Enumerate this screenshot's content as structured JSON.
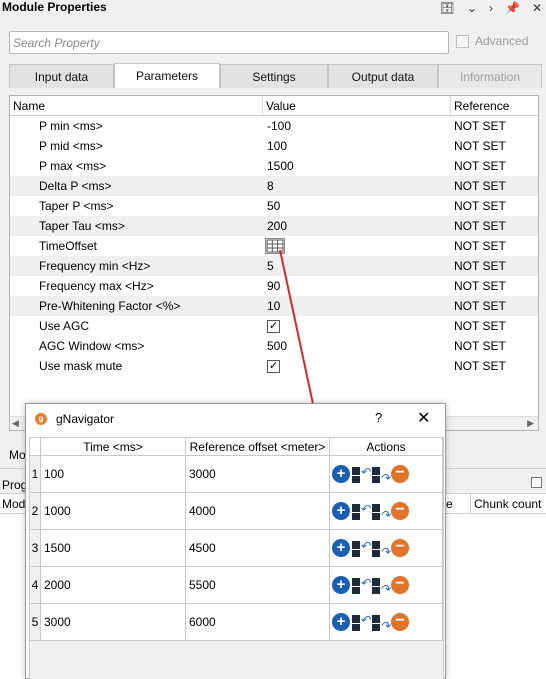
{
  "panel": {
    "title": "Module Properties",
    "search_placeholder": "Search Property",
    "advanced_label": "Advanced"
  },
  "header_icons": [
    "database-settings-icon",
    "chevron-down-icon",
    "chevron-right-icon",
    "pin-icon",
    "close-icon"
  ],
  "tabs": [
    {
      "label": "Input data"
    },
    {
      "label": "Parameters"
    },
    {
      "label": "Settings"
    },
    {
      "label": "Output data"
    },
    {
      "label": "Information"
    }
  ],
  "table": {
    "headers": {
      "name": "Name",
      "value": "Value",
      "reference": "Reference"
    },
    "rows": [
      {
        "name": "P min <ms>",
        "value": "-100",
        "reference": "NOT SET"
      },
      {
        "name": "P mid <ms>",
        "value": "100",
        "reference": "NOT SET"
      },
      {
        "name": "P max <ms>",
        "value": "1500",
        "reference": "NOT SET"
      },
      {
        "name": "Delta P <ms>",
        "value": "8",
        "reference": "NOT SET"
      },
      {
        "name": "Taper P <ms>",
        "value": "50",
        "reference": "NOT SET"
      },
      {
        "name": "Taper Tau <ms>",
        "value": "200",
        "reference": "NOT SET"
      },
      {
        "name": "TimeOffset",
        "value": "",
        "reference": "NOT SET"
      },
      {
        "name": "Frequency min <Hz>",
        "value": "5",
        "reference": "NOT SET"
      },
      {
        "name": "Frequency max <Hz>",
        "value": "90",
        "reference": "NOT SET"
      },
      {
        "name": "Pre-Whitening Factor <%>",
        "value": "10",
        "reference": "NOT SET"
      },
      {
        "name": "Use AGC",
        "value": "",
        "reference": "NOT SET"
      },
      {
        "name": "AGC Window <ms>",
        "value": "500",
        "reference": "NOT SET"
      },
      {
        "name": "Use mask mute",
        "value": "",
        "reference": "NOT SET"
      }
    ]
  },
  "background": {
    "mo": "Mo",
    "prog": "Prog",
    "mod": "Mod",
    "e": "e",
    "chunk_count": "Chunk count"
  },
  "dialog": {
    "title": "gNavigator",
    "help": "?",
    "close": "✕",
    "headers": {
      "time": "Time <ms>",
      "offset": "Reference offset <meter>",
      "actions": "Actions"
    },
    "rows": [
      {
        "n": "1",
        "time": "100",
        "offset": "3000"
      },
      {
        "n": "2",
        "time": "1000",
        "offset": "4000"
      },
      {
        "n": "3",
        "time": "1500",
        "offset": "4500"
      },
      {
        "n": "4",
        "time": "2000",
        "offset": "5500"
      },
      {
        "n": "5",
        "time": "3000",
        "offset": "6000"
      }
    ]
  },
  "colors": {
    "accent_blue": "#1b5fb4",
    "remove_orange": "#e1732a",
    "annotation_red": "#d42a2a"
  }
}
